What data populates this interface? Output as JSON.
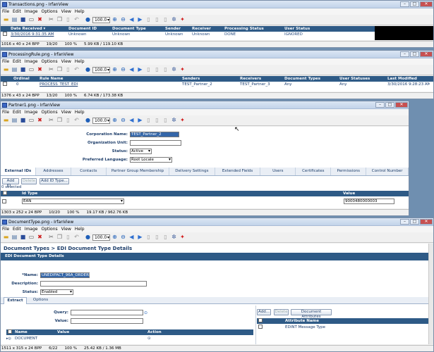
{
  "w1": {
    "title": "Transactions.png - IrfanView",
    "zoom": "100.0",
    "headers": [
      "Date Received ▾",
      "Document ID",
      "Document Type",
      "Sender",
      "Receiver",
      "Processing Status",
      "User Status"
    ],
    "row": [
      "3/30/2016 9:31:35 AM",
      "Unknown",
      "Unknown",
      "Unknown",
      "Unknown",
      "DONE",
      "IGNORED"
    ],
    "status": [
      "1016 x 40 x 24 BPP",
      "19/20",
      "100 %",
      "5.99 KB / 119.10 KB"
    ]
  },
  "w2": {
    "title": "ProcessingRule.png - IrfanView",
    "zoom": "100.0",
    "headers": [
      "Ordinal",
      "Rule Name",
      "Senders",
      "Receivers",
      "Document Types",
      "User Statuses",
      "Last Modified"
    ],
    "row": [
      "0",
      "PROCESS_TEST_EDI",
      "TEST_Partner_2",
      "TEST_Partner_3",
      "Any",
      "Any",
      "3/30/2016 9:28:23 AM"
    ],
    "status": [
      "1376 x 43 x 24 BPP",
      "13/20",
      "100 %",
      "6.74 KB / 173.38 KB"
    ]
  },
  "w3": {
    "title": "Partner1.png - IrfanView",
    "zoom": "100.0",
    "labels": {
      "corp": "Corporation Name:",
      "unit": "Organization Unit:",
      "status": "Status:",
      "lang": "Preferred Language:"
    },
    "values": {
      "corp": "TEST_Partner_2",
      "unit": "",
      "status": "Active",
      "lang": "Root Locale"
    },
    "tabs": [
      "External IDs",
      "Addresses",
      "Contacts",
      "Partner Group Membership",
      "Delivery Settings",
      "Extended Fields",
      "Users",
      "Certificates",
      "Permissions",
      "Control Number"
    ],
    "add_btn": "Add ID...",
    "delete_btn": "Delete",
    "add_type_btn": "Add ID Type...",
    "selected": "0 selected",
    "col_idtype": "Id Type",
    "col_value": "Value",
    "idtype": "EAN",
    "idvalue": "9000480000003",
    "status": [
      "1303 x 252 x 24 BPP",
      "10/20",
      "100 %",
      "19.17 KB / 962.76 KB"
    ]
  },
  "w4": {
    "title": "DocumentType.png - IrfanView",
    "zoom": "100.0",
    "breadcrumb": "Document Types > EDI Document Type Details",
    "section": "EDI Document Type Details",
    "labels": {
      "name": "*Name:",
      "desc": "Description:",
      "status": "Status:"
    },
    "values": {
      "name": "UNEDIFACT_96A_ORDERS",
      "desc": "",
      "status": "Enabled"
    },
    "tabs": [
      "Extract",
      "Options"
    ],
    "query": "Query:",
    "value": "Value:",
    "col_name": "Name",
    "col_value": "Value",
    "col_action": "Action",
    "row_name": "DOCUMENT",
    "add": "Add...",
    "delete": "Delete",
    "doc_attr": "Document Attributes",
    "col_attr": "Attribute Name",
    "attr": "EDINT Message Type",
    "status": [
      "1511 x 315 x 24 BPP",
      "6/22",
      "100 %",
      "25.42 KB / 1.36 MB"
    ]
  },
  "menu": [
    "File",
    "Edit",
    "Image",
    "Options",
    "View",
    "Help"
  ],
  "win_buttons": {
    "min": "–",
    "max": "□",
    "close": "✕"
  },
  "colors": {
    "header_bg": "#2e5a86",
    "link": "#1a3c6e",
    "title_gradient": "#c2d3ea"
  }
}
